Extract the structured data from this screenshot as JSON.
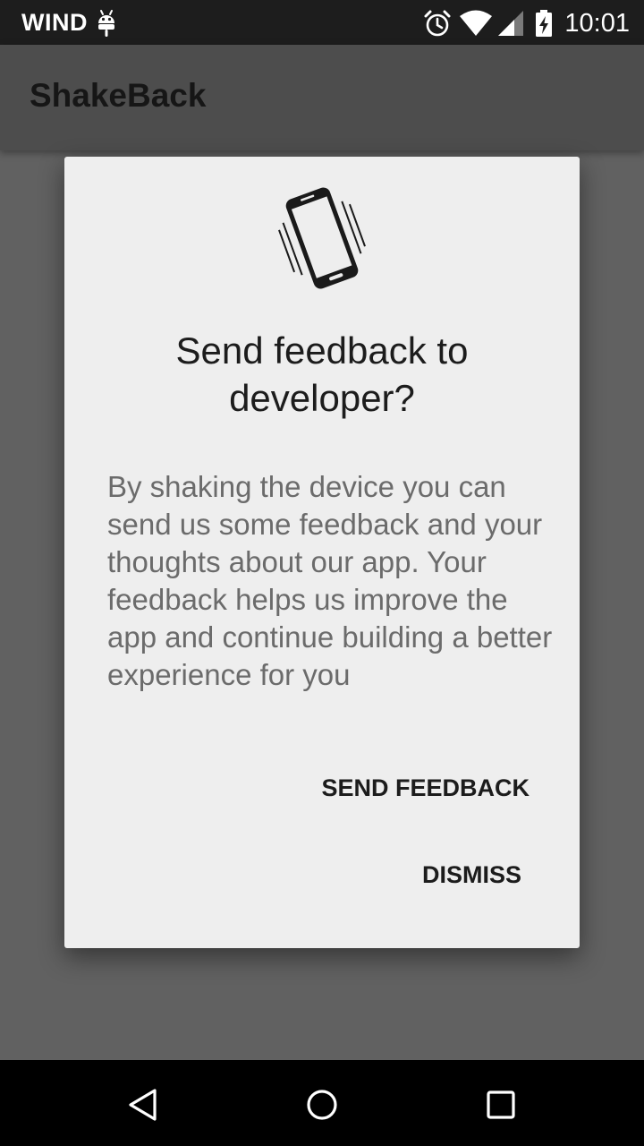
{
  "status_bar": {
    "carrier": "WIND",
    "time": "10:01",
    "icons": [
      "android-icon",
      "alarm-icon",
      "wifi-icon",
      "signal-icon",
      "battery-charging-icon"
    ]
  },
  "app_bar": {
    "title": "ShakeBack"
  },
  "dialog": {
    "icon": "shaking-phone-icon",
    "title": "Send feedback to developer?",
    "message": "By shaking the device you can send us some feedback and your thoughts about our app. Your feedback helps us improve the app and continue building a better experience for you",
    "send_label": "SEND FEEDBACK",
    "dismiss_label": "DISMISS"
  },
  "nav_bar": {
    "icons": [
      "back-icon",
      "home-icon",
      "recents-icon"
    ]
  },
  "colors": {
    "scrim": "#616161",
    "app_bar": "#4d4d4d",
    "dialog_bg": "#eeeeee",
    "status_bar": "#1d1d1d",
    "nav_bar": "#000000"
  }
}
